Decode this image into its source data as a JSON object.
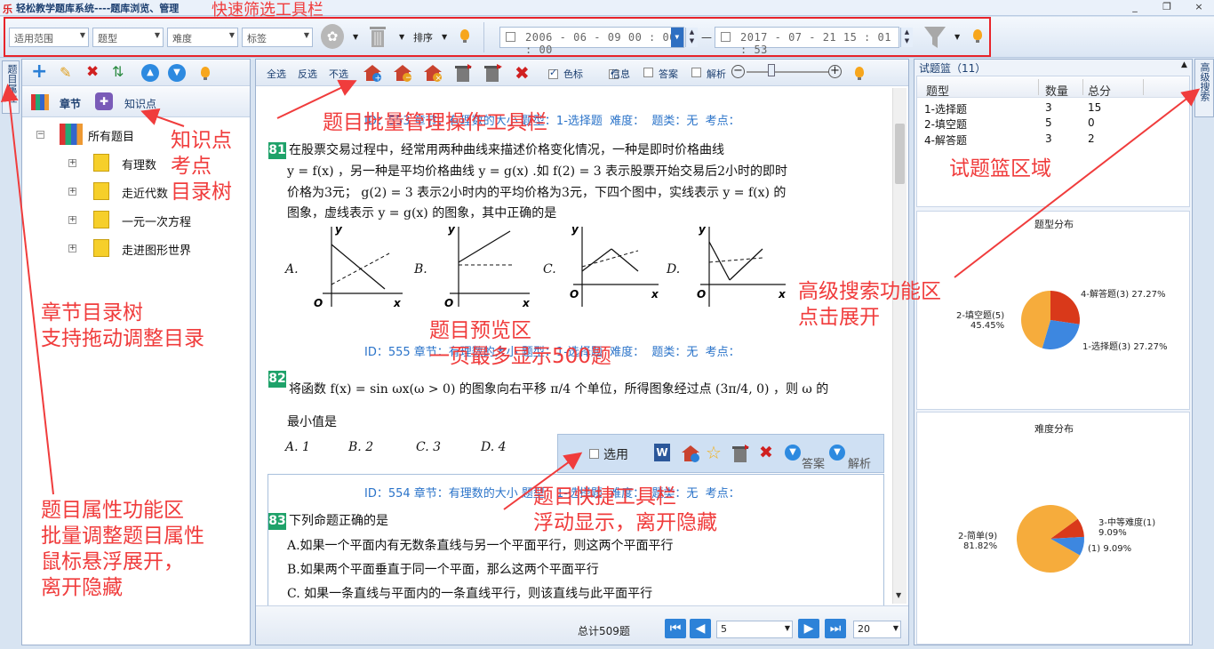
{
  "app": {
    "title": "轻松教学题库系统----题库浏览、管理",
    "window_buttons": [
      "_",
      "❐",
      "×"
    ]
  },
  "filter": {
    "scope": "适用范围",
    "qtype": "题型",
    "difficulty": "难度",
    "tag": "标签",
    "sort": "排序",
    "date_from": "2006 - 06 - 09    00 : 00 : 00",
    "date_to": "2017 - 07 - 21    15 : 01 : 53",
    "dash": "—"
  },
  "left": {
    "vtab": "题目属性",
    "tabs": {
      "chapter": "章节",
      "knowledge": "知识点"
    },
    "tree": {
      "root": "所有题目",
      "children": [
        "有理数",
        "走近代数",
        "一元一次方程",
        "走进图形世界"
      ]
    }
  },
  "center": {
    "toolbar": {
      "select_all": "全选",
      "invert": "反选",
      "deselect": "不选",
      "color": "色标",
      "info": "信息",
      "answer": "答案",
      "analysis": "解析"
    },
    "questions": [
      {
        "num": "81",
        "meta": "ID：553 章节：有理数的大小 题型：1-选择题  难度：  题类：无  考点：",
        "lines": [
          "在股票交易过程中，经常用两种曲线来描述价格变化情况，一种是即时价格曲线",
          "y = f(x) ，另一种是平均价格曲线 y = g(x) .如 f(2) = 3 表示股票开始交易后2小时的即时",
          "价格为3元； g(2) = 3 表示2小时内的平均价格为3元，下四个图中，实线表示 y = f(x) 的",
          "图象，虚线表示 y = g(x) 的图象，其中正确的是"
        ],
        "options": [
          "A.",
          "B.",
          "C.",
          "D."
        ],
        "axis_y": "y",
        "axis_x": "x",
        "origin": "O"
      },
      {
        "num": "82",
        "meta": "ID：555 章节：有理数的大小 题型：1-选择题  难度：  题类：无  考点：",
        "lines": [
          "将函数 f(x) = sin ωx(ω > 0) 的图象向右平移 π/4 个单位，所得图象经过点 (3π/4, 0) ，则 ω 的",
          "最小值是"
        ],
        "options": [
          "A. 1",
          "B. 2",
          "C. 3",
          "D. 4"
        ]
      },
      {
        "num": "83",
        "meta": "ID：554 章节：有理数的大小 题型：1-选择题  难度：  题类：无  考点：",
        "lines": [
          "下列命题正确的是",
          "A.如果一个平面内有无数条直线与另一个平面平行，则这两个平面平行",
          "B.如果两个平面垂直于同一个平面，那么这两个平面平行",
          "C. 如果一条直线与平面内的一条直线平行，则该直线与此平面平行"
        ]
      }
    ],
    "float": {
      "use": "选用",
      "answer": "答案",
      "analysis": "解析"
    },
    "pager": {
      "total": "总计509题",
      "page": "5",
      "size": "20"
    }
  },
  "right": {
    "header": "试题篮（11）",
    "vtab": "高级搜索",
    "basket": {
      "cols": [
        "题型",
        "数量",
        "总分"
      ],
      "rows": [
        [
          "1-选择题",
          "3",
          "15"
        ],
        [
          "2-填空题",
          "5",
          "0"
        ],
        [
          "4-解答题",
          "3",
          "2"
        ]
      ]
    }
  },
  "chart_data": [
    {
      "type": "pie",
      "title": "题型分布",
      "slices": [
        {
          "label": "4-解答题(3) 27.27%",
          "value": 27.27,
          "color": "#d9391a"
        },
        {
          "label": "1-选择题(3) 27.27%",
          "value": 27.27,
          "color": "#3d87e0"
        },
        {
          "label": "2-填空题(5)\n45.45%",
          "value": 45.45,
          "color": "#f6ac3c"
        }
      ]
    },
    {
      "type": "pie",
      "title": "难度分布",
      "slices": [
        {
          "label": "3-中等难度(1)\n9.09%",
          "value": 9.09,
          "color": "#d9391a"
        },
        {
          "label": "(1) 9.09%",
          "value": 9.09,
          "color": "#3d87e0"
        },
        {
          "label": "2-简单(9)\n81.82%",
          "value": 81.82,
          "color": "#f6ac3c"
        }
      ]
    }
  ],
  "annotations": {
    "filter": "快速筛选工具栏",
    "batch": "题目批量管理操作工具栏",
    "knowledge": "知识点\n考点\n目录树",
    "basket": "试题篮区域",
    "search": "高级搜索功能区\n点击展开",
    "preview": "题目预览区\n一页最多显示500题",
    "chapter": "章节目录树\n支持拖动调整目录",
    "quick": "题目快捷工具栏\n浮动显示，离开隐藏",
    "attr": "题目属性功能区\n批量调整题目属性\n鼠标悬浮展开，\n离开隐藏"
  }
}
